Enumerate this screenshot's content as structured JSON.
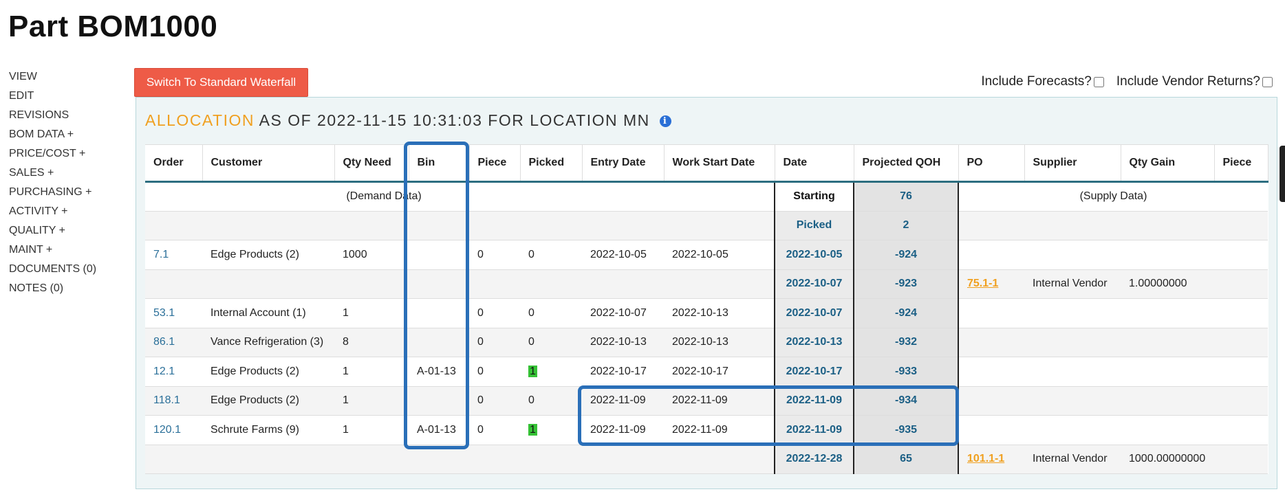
{
  "page": {
    "title": "Part BOM1000"
  },
  "nav": {
    "items": [
      {
        "label": "VIEW",
        "name": "nav-view"
      },
      {
        "label": "EDIT",
        "name": "nav-edit"
      },
      {
        "label": "REVISIONS",
        "name": "nav-revisions"
      },
      {
        "label": "BOM DATA +",
        "name": "nav-bom-data"
      },
      {
        "label": "PRICE/COST +",
        "name": "nav-price-cost"
      },
      {
        "label": "SALES +",
        "name": "nav-sales"
      },
      {
        "label": "PURCHASING +",
        "name": "nav-purchasing"
      },
      {
        "label": "ACTIVITY +",
        "name": "nav-activity"
      },
      {
        "label": "QUALITY +",
        "name": "nav-quality"
      },
      {
        "label": "MAINT +",
        "name": "nav-maint"
      },
      {
        "label": "DOCUMENTS (0)",
        "name": "nav-documents"
      },
      {
        "label": "NOTES (0)",
        "name": "nav-notes"
      }
    ]
  },
  "toolbar": {
    "switch_label": "Switch To Standard Waterfall",
    "include_forecasts": "Include Forecasts?",
    "include_vendor_returns": "Include Vendor Returns?"
  },
  "allocation": {
    "title_accent": "ALLOCATION",
    "title_rest": "AS OF 2022-11-15 10:31:03 FOR LOCATION MN",
    "info_icon": "i",
    "columns": [
      "Order",
      "Customer",
      "Qty Need",
      "Bin",
      "Piece",
      "Picked",
      "Entry Date",
      "Work Start Date",
      "Date",
      "Projected QOH",
      "PO",
      "Supplier",
      "Qty Gain",
      "Piece"
    ],
    "starting_row": {
      "demand_note": "(Demand Data)",
      "date_label": "Starting",
      "qoh": "76",
      "supply_note": "(Supply Data)"
    },
    "picked_row": {
      "date_label": "Picked",
      "qoh": "2"
    },
    "rows": [
      {
        "order": "7.1",
        "customer": "Edge Products (2)",
        "qty_need": "1000",
        "bin": "",
        "piece": "0",
        "picked": "0",
        "entry_date": "2022-10-05",
        "work_start": "2022-10-05",
        "date": "2022-10-05",
        "qoh": "-924",
        "po": "",
        "supplier": "",
        "qty_gain": "",
        "piece2": ""
      },
      {
        "order": "",
        "customer": "",
        "qty_need": "",
        "bin": "",
        "piece": "",
        "picked": "",
        "entry_date": "",
        "work_start": "",
        "date": "2022-10-07",
        "qoh": "-923",
        "po": "75.1-1",
        "supplier": "Internal Vendor",
        "qty_gain": "1.00000000",
        "piece2": ""
      },
      {
        "order": "53.1",
        "customer": "Internal Account (1)",
        "qty_need": "1",
        "bin": "",
        "piece": "0",
        "picked": "0",
        "entry_date": "2022-10-07",
        "work_start": "2022-10-13",
        "date": "2022-10-07",
        "qoh": "-924",
        "po": "",
        "supplier": "",
        "qty_gain": "",
        "piece2": ""
      },
      {
        "order": "86.1",
        "customer": "Vance Refrigeration (3)",
        "qty_need": "8",
        "bin": "",
        "piece": "0",
        "picked": "0",
        "entry_date": "2022-10-13",
        "work_start": "2022-10-13",
        "date": "2022-10-13",
        "qoh": "-932",
        "po": "",
        "supplier": "",
        "qty_gain": "",
        "piece2": ""
      },
      {
        "order": "12.1",
        "customer": "Edge Products (2)",
        "qty_need": "1",
        "bin": "A-01-13",
        "piece": "0",
        "picked": "1",
        "entry_date": "2022-10-17",
        "work_start": "2022-10-17",
        "date": "2022-10-17",
        "qoh": "-933",
        "po": "",
        "supplier": "",
        "qty_gain": "",
        "piece2": ""
      },
      {
        "order": "118.1",
        "customer": "Edge Products (2)",
        "qty_need": "1",
        "bin": "",
        "piece": "0",
        "picked": "0",
        "entry_date": "2022-11-09",
        "work_start": "2022-11-09",
        "date": "2022-11-09",
        "qoh": "-934",
        "po": "",
        "supplier": "",
        "qty_gain": "",
        "piece2": ""
      },
      {
        "order": "120.1",
        "customer": "Schrute Farms (9)",
        "qty_need": "1",
        "bin": "A-01-13",
        "piece": "0",
        "picked": "1",
        "entry_date": "2022-11-09",
        "work_start": "2022-11-09",
        "date": "2022-11-09",
        "qoh": "-935",
        "po": "",
        "supplier": "",
        "qty_gain": "",
        "piece2": ""
      },
      {
        "order": "",
        "customer": "",
        "qty_need": "",
        "bin": "",
        "piece": "",
        "picked": "",
        "entry_date": "",
        "work_start": "",
        "date": "2022-12-28",
        "qoh": "65",
        "po": "101.1-1",
        "supplier": "Internal Vendor",
        "qty_gain": "1000.00000000",
        "piece2": ""
      }
    ]
  },
  "colors": {
    "button": "#ee5b47",
    "accent": "#f0a020",
    "link": "#2a6f99",
    "highlight": "#2a6fb8",
    "picked_badge": "#35c135"
  }
}
